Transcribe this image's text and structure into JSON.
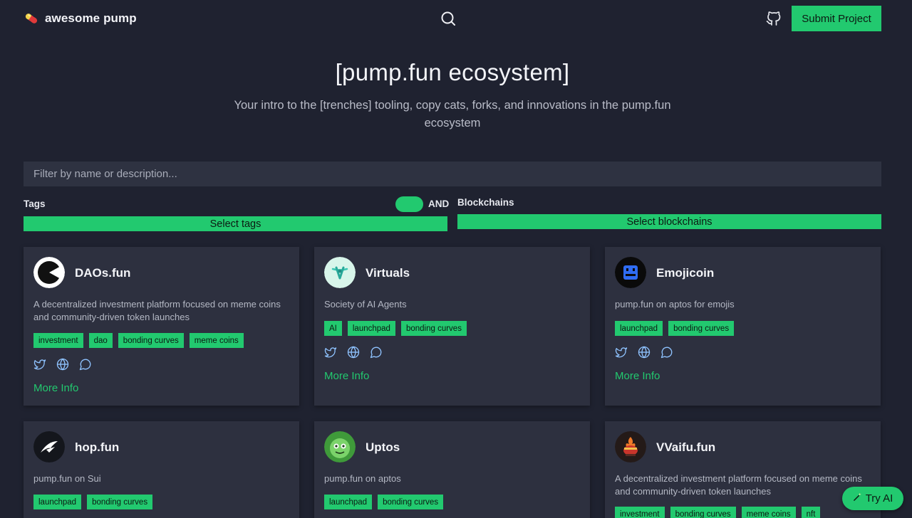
{
  "header": {
    "logo_text": "awesome pump",
    "submit_label": "Submit Project"
  },
  "hero": {
    "title": "[pump.fun ecosystem]",
    "subtitle": "Your intro to the [trenches] tooling, copy cats, forks, and innovations in the pump.fun ecosystem"
  },
  "filter": {
    "placeholder": "Filter by name or description...",
    "tags_label": "Tags",
    "and_label": "AND",
    "toggle_on": true,
    "blockchains_label": "Blockchains",
    "select_tags_label": "Select tags",
    "select_blockchains_label": "Select blockchains"
  },
  "more_info_label": "More Info",
  "cards": [
    {
      "name": "DAOs.fun",
      "description": "A decentralized investment platform focused on meme coins and community-driven token launches",
      "tags": [
        "investment",
        "dao",
        "bonding curves",
        "meme coins"
      ],
      "avatar": "daos-logo"
    },
    {
      "name": "Virtuals",
      "description": "Society of AI Agents",
      "tags": [
        "AI",
        "launchpad",
        "bonding curves"
      ],
      "avatar": "virtuals-logo"
    },
    {
      "name": "Emojicoin",
      "description": "pump.fun on aptos for emojis",
      "tags": [
        "launchpad",
        "bonding curves"
      ],
      "avatar": "emojicoin-logo"
    },
    {
      "name": "hop.fun",
      "description": "pump.fun on Sui",
      "tags": [
        "launchpad",
        "bonding curves"
      ],
      "avatar": "hop-logo"
    },
    {
      "name": "Uptos",
      "description": "pump.fun on aptos",
      "tags": [
        "launchpad",
        "bonding curves"
      ],
      "avatar": "uptos-logo"
    },
    {
      "name": "VVaifu.fun",
      "description": "A decentralized investment platform focused on meme coins and community-driven token launches",
      "tags": [
        "investment",
        "bonding curves",
        "meme coins",
        "nft"
      ],
      "avatar": "vvaifu-logo"
    }
  ],
  "try_ai_label": "Try AI",
  "colors": {
    "background": "#1f2230",
    "card": "#2d303f",
    "accent": "#22c96f"
  }
}
